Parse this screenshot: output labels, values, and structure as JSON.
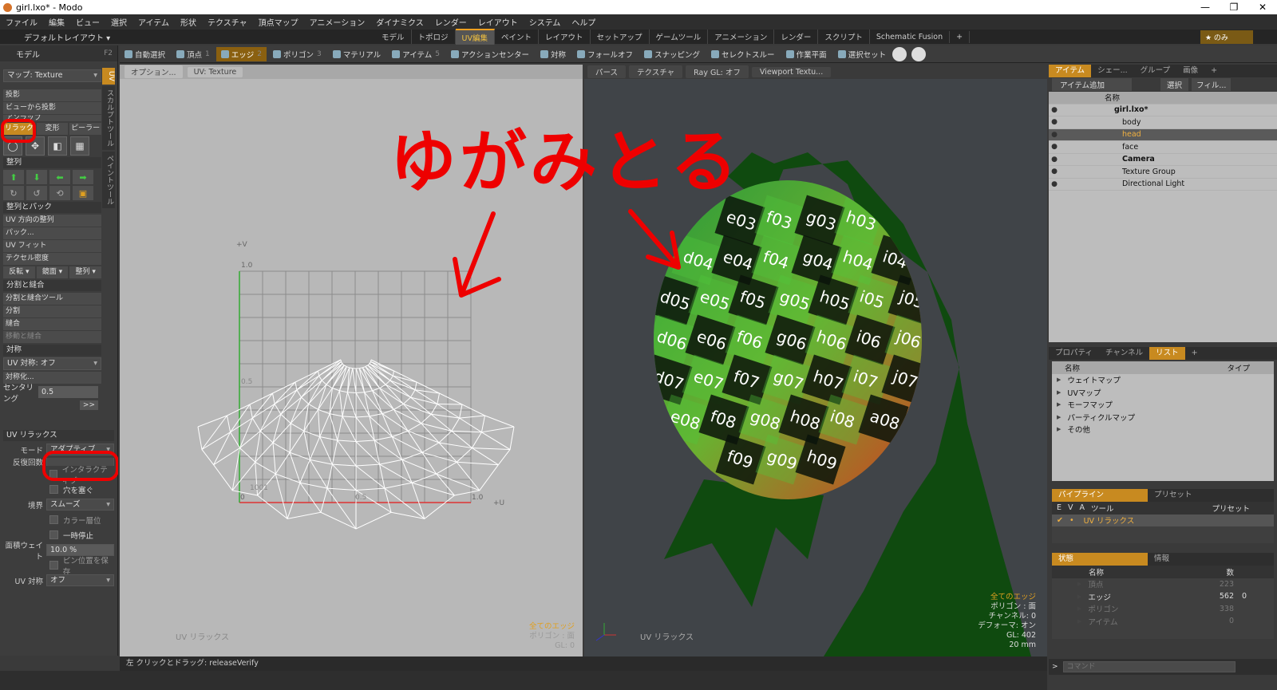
{
  "window": {
    "title": "girl.lxo* - Modo",
    "buttons": [
      "—",
      "❐",
      "✕"
    ]
  },
  "menu": [
    "ファイル",
    "編集",
    "ビュー",
    "選択",
    "アイテム",
    "形状",
    "テクスチャ",
    "頂点マップ",
    "アニメーション",
    "ダイナミクス",
    "レンダー",
    "レイアウト",
    "システム",
    "ヘルプ"
  ],
  "layout": {
    "name": "デフォルトレイアウト ▾",
    "tabs": [
      "モデル",
      "トポロジ",
      "UV編集",
      "ペイント",
      "レイアウト",
      "セットアップ",
      "ゲームツール",
      "アニメーション",
      "レンダー",
      "スクリプト",
      "Schematic Fusion",
      "+"
    ],
    "active_tab": "UV編集",
    "star_label": "★ のみ"
  },
  "toolbar": {
    "items": [
      {
        "label": "自動選択",
        "num": ""
      },
      {
        "label": "頂点",
        "num": "1"
      },
      {
        "label": "エッジ",
        "num": "2"
      },
      {
        "label": "ポリゴン",
        "num": "3"
      },
      {
        "label": "マテリアル",
        "num": ""
      },
      {
        "label": "アイテム",
        "num": "5"
      },
      {
        "label": "アクションセンター",
        "num": ""
      },
      {
        "label": "対称",
        "num": ""
      },
      {
        "label": "フォールオフ",
        "num": ""
      },
      {
        "label": "スナッピング",
        "num": ""
      },
      {
        "label": "セレクトスルー",
        "num": ""
      },
      {
        "label": "作業平面",
        "num": ""
      },
      {
        "label": "選択セット",
        "num": ""
      }
    ],
    "active": "エッジ"
  },
  "left": {
    "header": "モデル",
    "header_key": "F2",
    "map": "マップ: Texture",
    "proj": [
      "投影",
      "ビューから投影",
      "アンラップ"
    ],
    "seg": [
      "リラックス",
      "変形",
      "ピーラー"
    ],
    "seg_active": "リラックス",
    "align_head": "整列",
    "pack_head": "整列とパック",
    "pack_items": [
      "UV 方向の整列",
      "パック...",
      "UV フィット",
      "テクセル密度"
    ],
    "pack_dd": [
      "反転 ▾",
      "鏡面 ▾",
      "整列 ▾"
    ],
    "split_head": "分割と縫合",
    "split_items": [
      "分割と縫合ツール",
      "分割",
      "縫合",
      "移動と縫合"
    ],
    "sym_head": "対称",
    "sym_dd": "UV 対称: オフ",
    "sym_btn": "対称化...",
    "center_lbl": "センタリング",
    "center_val": "0.5",
    "more": ">>",
    "vtabs": [
      "UV",
      "スカルプトツール",
      "ペイントツール"
    ]
  },
  "relax": {
    "head": "UV リラックス",
    "mode_lbl": "モード",
    "mode_val": "アダプティブ",
    "iter_lbl": "反復回数",
    "interactive": "インタラクティブ",
    "fill": "穴を塞ぐ",
    "border_lbl": "境界",
    "border_val": "スムーズ",
    "one_layer": "カラー層位",
    "pause": "一時停止",
    "area_lbl": "面積ウェイト",
    "area_val": "10.0 %",
    "pin": "ピン位置を保存",
    "uvsym_lbl": "UV 対称",
    "uvsym_val": "オフ"
  },
  "uv": {
    "opt_btn": "オプション...",
    "map_btn": "UV: Texture",
    "axis_v": "+V",
    "axis_u": "+U",
    "t_1v": "1.0",
    "t_05v": "0.5",
    "t_0": "0",
    "t_05u": "0.5",
    "t_1u": "1.0",
    "udim": "1001",
    "tool_label": "UV リラックス",
    "ovl": [
      "全てのエッジ",
      "ポリゴン : 面",
      "GL: 0"
    ]
  },
  "vp": {
    "head": [
      "パース",
      "テクスチャ",
      "Ray GL: オフ",
      "Viewport Textu..."
    ],
    "tool_label": "UV リラックス",
    "ovl": [
      "全てのエッジ",
      "ポリゴン : 面",
      "チャンネル: 0",
      "デフォーマ: オン",
      "GL: 402",
      "20 mm"
    ],
    "checker": [
      [
        "e03",
        "f03",
        "g03",
        "h03"
      ],
      [
        "d04",
        "e04",
        "f04",
        "g04",
        "h04",
        "i04"
      ],
      [
        "d05",
        "e05",
        "f05",
        "g05",
        "h05",
        "i05",
        "j05"
      ],
      [
        "d06",
        "e06",
        "f06",
        "g06",
        "h06",
        "i06",
        "j06"
      ],
      [
        "d07",
        "e07",
        "f07",
        "g07",
        "h07",
        "i07",
        "j07"
      ],
      [
        "e08",
        "f08",
        "g08",
        "h08",
        "i08",
        "a08"
      ],
      [
        "f09",
        "g09",
        "h09"
      ]
    ]
  },
  "annotation": {
    "text": "ゆがみとる",
    "color": "#e00000"
  },
  "items": {
    "tabs": [
      "アイテム",
      "シェー...",
      "グループ",
      "画像",
      "+"
    ],
    "add_btn": "アイテム追加",
    "select_btn": "選択",
    "filter_btn": "フィル...",
    "col_name": "名称",
    "rows": [
      {
        "name": "girl.lxo*",
        "indent": 0,
        "bold": true
      },
      {
        "name": "body",
        "indent": 1
      },
      {
        "name": "head",
        "indent": 1
      },
      {
        "name": "face",
        "indent": 1
      },
      {
        "name": "Camera",
        "indent": 1,
        "bold": true
      },
      {
        "name": "Texture Group",
        "indent": 1
      },
      {
        "name": "Directional Light",
        "indent": 1
      }
    ],
    "selected": "head"
  },
  "props": {
    "tabs": [
      "プロパティ",
      "チャンネル",
      "リスト",
      "+"
    ],
    "active": "リスト",
    "col_name": "名称",
    "col_type": "タイプ",
    "rows": [
      "ウェイトマップ",
      "UVマップ",
      "モーフマップ",
      "パーティクルマップ",
      "その他"
    ]
  },
  "pipeline": {
    "tabs": [
      "パイプライン",
      "プリセット"
    ],
    "cols": [
      "E",
      "V",
      "A",
      "ツール",
      "プリセット"
    ],
    "row": "UV リラックス"
  },
  "stats": {
    "tabs": [
      "状態",
      "情報"
    ],
    "cols": [
      "名称",
      "数"
    ],
    "rows": [
      {
        "name": "頂点",
        "count": "223",
        "sel": ""
      },
      {
        "name": "エッジ",
        "count": "562",
        "sel": "0"
      },
      {
        "name": "ポリゴン",
        "count": "338",
        "sel": ""
      },
      {
        "name": "アイテム",
        "count": "0",
        "sel": ""
      }
    ]
  },
  "command_placeholder": "コマンド",
  "status": "左 クリックとドラッグ:  releaseVerify"
}
